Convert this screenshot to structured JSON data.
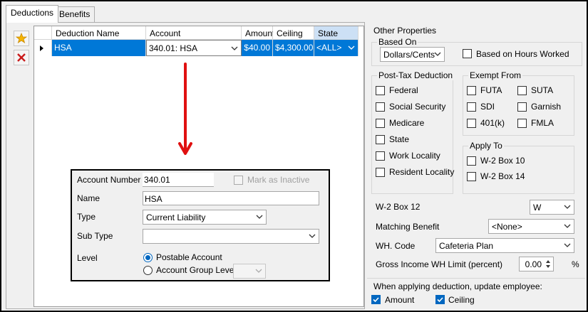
{
  "tabs": [
    {
      "label": "Deductions",
      "active": true
    },
    {
      "label": "Benefits",
      "active": false
    }
  ],
  "grid": {
    "columns": [
      "Deduction Name",
      "Account",
      "Amount",
      "Ceiling",
      "State"
    ],
    "row": {
      "name": "HSA",
      "account": "340.01: HSA",
      "amount": "$40.00",
      "ceiling": "$4,300.00",
      "state": "<ALL>"
    }
  },
  "popup": {
    "account_number_label": "Account Number",
    "account_number": "340.01",
    "mark_inactive_label": "Mark as Inactive",
    "name_label": "Name",
    "name_value": "HSA",
    "type_label": "Type",
    "type_value": "Current Liability",
    "subtype_label": "Sub Type",
    "subtype_value": "",
    "level_label": "Level",
    "postable_label": "Postable Account",
    "group_level_label": "Account Group Level"
  },
  "other": {
    "title": "Other Properties",
    "based_on_title": "Based On",
    "based_on_value": "Dollars/Cents",
    "based_on_hours_label": "Based on Hours Worked",
    "post_tax_title": "Post-Tax Deduction",
    "post_tax_items": [
      "Federal",
      "Social Security",
      "Medicare",
      "State",
      "Work Locality",
      "Resident Locality"
    ],
    "exempt_title": "Exempt From",
    "exempt_left": [
      "FUTA",
      "SDI",
      "401(k)"
    ],
    "exempt_right": [
      "SUTA",
      "Garnish",
      "FMLA"
    ],
    "apply_title": "Apply To",
    "apply_items": [
      "W-2 Box 10",
      "W-2 Box 14"
    ],
    "w2_box12_label": "W-2 Box 12",
    "w2_box12_value": "W",
    "matching_label": "Matching Benefit",
    "matching_value": "<None>",
    "wh_code_label": "WH. Code",
    "wh_code_value": "Cafeteria Plan",
    "gross_label": "Gross Income WH Limit (percent)",
    "gross_value": "0.00",
    "gross_unit": "%",
    "update_title": "When applying deduction, update employee:",
    "update_amount_label": "Amount",
    "update_ceiling_label": "Ceiling"
  },
  "colors": {
    "selection_blue": "#0078d7",
    "arrow_red": "#e01010",
    "checkbox_blue": "#0067c0"
  }
}
